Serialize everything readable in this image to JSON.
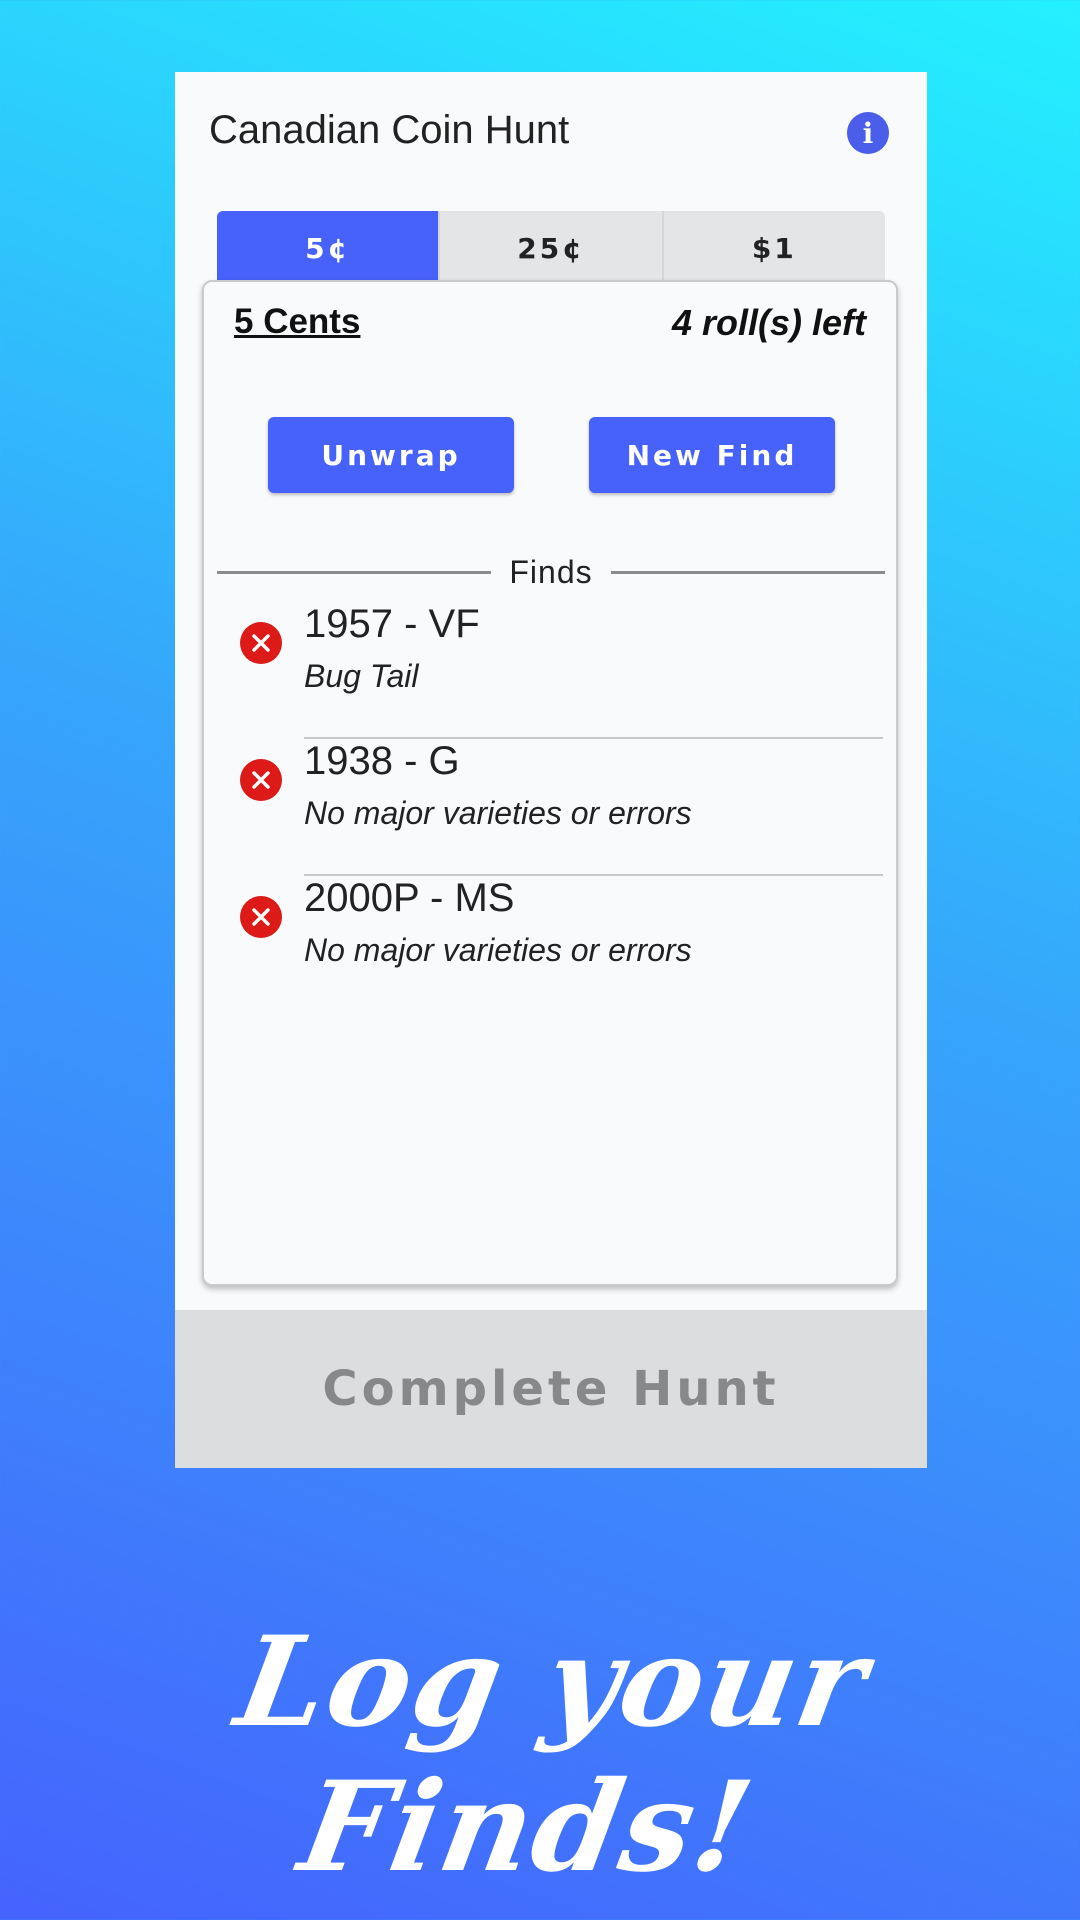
{
  "app": {
    "title": "Canadian Coin Hunt",
    "info_icon": "info-icon",
    "accent_color": "#4762fa"
  },
  "tabs": [
    {
      "label": "5¢",
      "active": true
    },
    {
      "label": "25¢",
      "active": false
    },
    {
      "label": "$1",
      "active": false
    }
  ],
  "card": {
    "title": "5 Cents",
    "rolls_left": "4 roll(s) left",
    "unwrap_label": "Unwrap",
    "new_find_label": "New Find",
    "finds_label": "Finds"
  },
  "finds": [
    {
      "name": "1957 - VF",
      "note": "Bug Tail"
    },
    {
      "name": "1938 - G",
      "note": "No major varieties or errors"
    },
    {
      "name": "2000P - MS",
      "note": "No major varieties or errors"
    }
  ],
  "complete_label": "Complete Hunt",
  "tagline": "Log your Finds!",
  "remove_color": "#dc1b18"
}
